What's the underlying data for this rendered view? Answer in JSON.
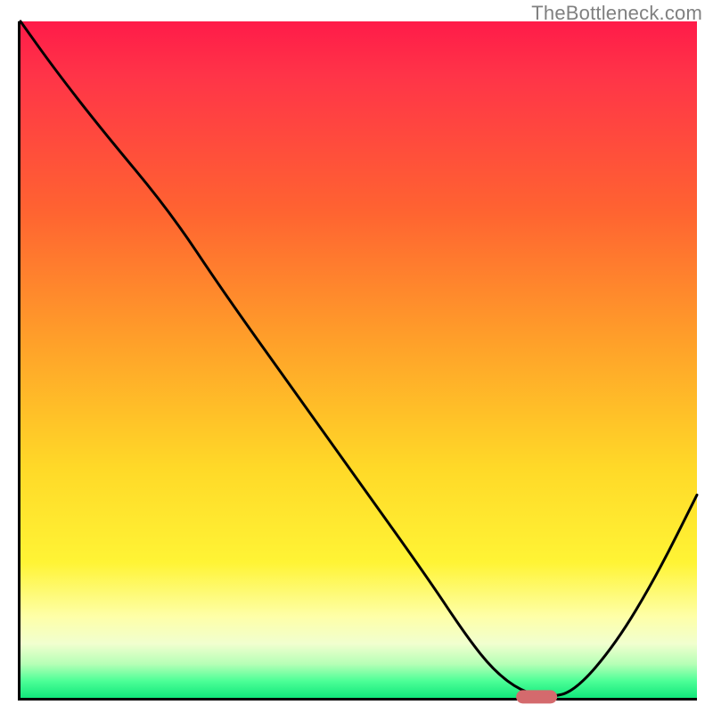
{
  "watermark": "TheBottleneck.com",
  "colors": {
    "axis": "#000000",
    "curve": "#000000",
    "marker": "#d46a6d",
    "gradient_top": "#ff1b49",
    "gradient_bottom": "#11e77b"
  },
  "chart_data": {
    "type": "line",
    "title": "",
    "xlabel": "",
    "ylabel": "",
    "xlim": [
      0,
      100
    ],
    "ylim": [
      0,
      100
    ],
    "background": "vertical red→orange→yellow→green gradient indicating bottleneck severity (red high, green low)",
    "series": [
      {
        "name": "bottleneck-curve",
        "x": [
          0,
          5,
          12,
          22,
          30,
          40,
          50,
          60,
          66,
          70,
          74,
          78,
          82,
          88,
          94,
          100
        ],
        "values": [
          100,
          93,
          84,
          72,
          60,
          46,
          32,
          18,
          9,
          4,
          1,
          0,
          1,
          8,
          18,
          30
        ]
      }
    ],
    "annotations": [
      {
        "name": "optimal-marker",
        "shape": "rounded-rect",
        "x": 76,
        "y": 0.5,
        "width_pct": 6,
        "height_pct": 2,
        "color": "#d46a6d"
      }
    ]
  }
}
